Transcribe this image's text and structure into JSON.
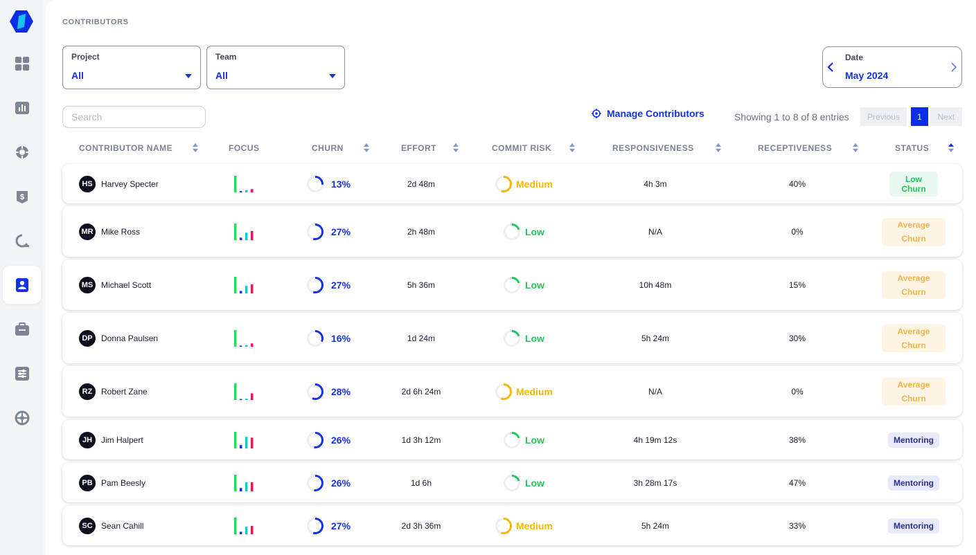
{
  "sidebar": {
    "items": [
      {
        "name": "dashboard",
        "icon": "grid-icon",
        "active": false
      },
      {
        "name": "reports",
        "icon": "bar-chart-icon",
        "active": false
      },
      {
        "name": "tracking",
        "icon": "target-icon",
        "active": false
      },
      {
        "name": "billing",
        "icon": "dollar-tag-icon",
        "active": false
      },
      {
        "name": "reviews",
        "icon": "refresh-search-icon",
        "active": false
      },
      {
        "name": "contributors",
        "icon": "user-badge-icon",
        "active": true
      },
      {
        "name": "projects",
        "icon": "briefcase-icon",
        "active": false
      },
      {
        "name": "settings",
        "icon": "sliders-icon",
        "active": false
      },
      {
        "name": "integrations",
        "icon": "network-icon",
        "active": false
      }
    ]
  },
  "page": {
    "title": "CONTRIBUTORS"
  },
  "filters": {
    "project": {
      "label": "Project",
      "value": "All"
    },
    "team": {
      "label": "Team",
      "value": "All"
    },
    "date": {
      "label": "Date",
      "value": "May 2024"
    }
  },
  "search": {
    "placeholder": "Search"
  },
  "manage": {
    "label": "Manage Contributors"
  },
  "pagination": {
    "showing": "Showing 1 to 8 of 8 entries",
    "previous": "Previous",
    "current": "1",
    "next": "Next"
  },
  "table": {
    "headers": {
      "name": "CONTRIBUTOR NAME",
      "focus": "FOCUS",
      "churn": "CHURN",
      "effort": "EFFORT",
      "risk": "COMMIT RISK",
      "responsiveness": "RESPONSIVENESS",
      "receptiveness": "RECEPTIVENESS",
      "status": "STATUS"
    },
    "rows": [
      {
        "initials": "HS",
        "name": "Harvey Specter",
        "focus": [
          1.0,
          0.08,
          0.12,
          0.2
        ],
        "churn": "13%",
        "churn_value": 0.13,
        "effort": "2d 48m",
        "risk": "Medium",
        "risk_value": 0.55,
        "responsiveness": "4h 3m",
        "receptiveness": "40%",
        "status": "Low Churn",
        "status_kind": "green"
      },
      {
        "initials": "MR",
        "name": "Mike Ross",
        "focus": [
          1.0,
          0.15,
          0.45,
          0.55
        ],
        "churn": "27%",
        "churn_value": 0.27,
        "effort": "2h 48m",
        "risk": "Low",
        "risk_value": 0.2,
        "responsiveness": "N/A",
        "receptiveness": "0%",
        "status": "Average Churn",
        "status_kind": "avg"
      },
      {
        "initials": "MS",
        "name": "Michael Scott",
        "focus": [
          1.0,
          0.15,
          0.45,
          0.55
        ],
        "churn": "27%",
        "churn_value": 0.27,
        "effort": "5h 36m",
        "risk": "Low",
        "risk_value": 0.2,
        "responsiveness": "10h 48m",
        "receptiveness": "15%",
        "status": "Average Churn",
        "status_kind": "avg"
      },
      {
        "initials": "DP",
        "name": "Donna Paulsen",
        "focus": [
          1.0,
          0.06,
          0.1,
          0.2
        ],
        "churn": "16%",
        "churn_value": 0.16,
        "effort": "1d 24m",
        "risk": "Low",
        "risk_value": 0.2,
        "responsiveness": "5h 24m",
        "receptiveness": "30%",
        "status": "Average Churn",
        "status_kind": "avg"
      },
      {
        "initials": "RZ",
        "name": "Robert Zane",
        "focus": [
          1.0,
          0.05,
          0.08,
          0.4
        ],
        "churn": "28%",
        "churn_value": 0.28,
        "effort": "2d 6h 24m",
        "risk": "Medium",
        "risk_value": 0.55,
        "responsiveness": "N/A",
        "receptiveness": "0%",
        "status": "Average Churn",
        "status_kind": "avg"
      },
      {
        "initials": "JH",
        "name": "Jim Halpert",
        "focus": [
          1.0,
          0.2,
          0.7,
          0.65
        ],
        "churn": "26%",
        "churn_value": 0.26,
        "effort": "1d 3h 12m",
        "risk": "Low",
        "risk_value": 0.2,
        "responsiveness": "4h 19m 12s",
        "receptiveness": "38%",
        "status": "Mentoring",
        "status_kind": "ment"
      },
      {
        "initials": "PB",
        "name": "Pam Beesly",
        "focus": [
          1.0,
          0.2,
          0.55,
          0.55
        ],
        "churn": "26%",
        "churn_value": 0.26,
        "effort": "1d 6h",
        "risk": "Low",
        "risk_value": 0.2,
        "responsiveness": "3h 28m 17s",
        "receptiveness": "47%",
        "status": "Mentoring",
        "status_kind": "ment"
      },
      {
        "initials": "SC",
        "name": "Sean Cahill",
        "focus": [
          1.0,
          0.15,
          0.45,
          0.5
        ],
        "churn": "27%",
        "churn_value": 0.27,
        "effort": "2d 3h 36m",
        "risk": "Medium",
        "risk_value": 0.55,
        "responsiveness": "5h 24m",
        "receptiveness": "33%",
        "status": "Mentoring",
        "status_kind": "ment"
      }
    ]
  },
  "colors": {
    "accent": "#1431e8",
    "low": "#22c55e",
    "medium": "#f5b800",
    "focus_bars": [
      "#22dd55",
      "#1431e8",
      "#17c6d8",
      "#e8195a"
    ]
  }
}
